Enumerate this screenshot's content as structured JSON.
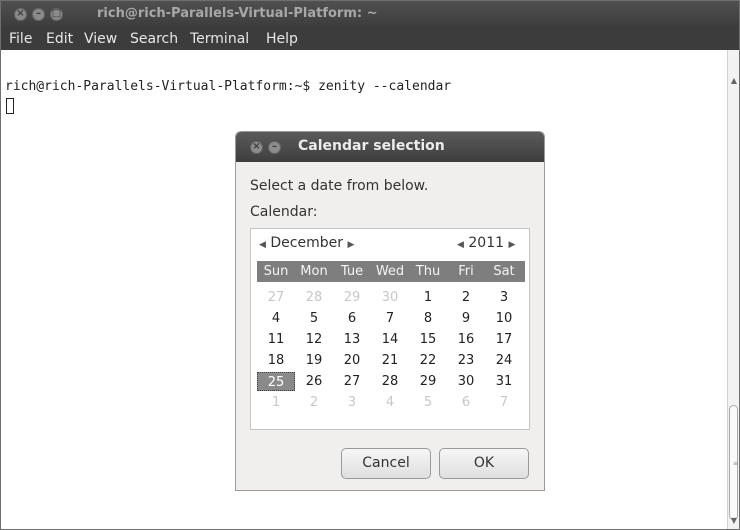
{
  "window": {
    "title": "rich@rich-Parallels-Virtual-Platform: ~",
    "menu": [
      "File",
      "Edit",
      "View",
      "Search",
      "Terminal",
      "Help"
    ]
  },
  "terminal": {
    "prompt_line": "rich@rich-Parallels-Virtual-Platform:~$ zenity --calendar"
  },
  "dialog": {
    "title": "Calendar selection",
    "prompt_text": "Select a date from below.",
    "calendar_label": "Calendar:",
    "month": "December",
    "year": "2011",
    "weekdays": [
      "Sun",
      "Mon",
      "Tue",
      "Wed",
      "Thu",
      "Fri",
      "Sat"
    ],
    "weeks": [
      [
        "27",
        "28",
        "29",
        "30",
        "1",
        "2",
        "3"
      ],
      [
        "4",
        "5",
        "6",
        "7",
        "8",
        "9",
        "10"
      ],
      [
        "11",
        "12",
        "13",
        "14",
        "15",
        "16",
        "17"
      ],
      [
        "18",
        "19",
        "20",
        "21",
        "22",
        "23",
        "24"
      ],
      [
        "25",
        "26",
        "27",
        "28",
        "29",
        "30",
        "31"
      ],
      [
        "1",
        "2",
        "3",
        "4",
        "5",
        "6",
        "7"
      ]
    ],
    "other_month_days": [
      [
        0,
        0
      ],
      [
        0,
        1
      ],
      [
        0,
        2
      ],
      [
        0,
        3
      ],
      [
        5,
        0
      ],
      [
        5,
        1
      ],
      [
        5,
        2
      ],
      [
        5,
        3
      ],
      [
        5,
        4
      ],
      [
        5,
        5
      ],
      [
        5,
        6
      ]
    ],
    "selected_day": "25",
    "cancel_label": "Cancel",
    "ok_label": "OK"
  },
  "colors": {
    "titlebar": "#3c3c3c",
    "dialog_bg": "#f0efed",
    "day_header_bg": "#7e7e7e",
    "selected_day_bg": "#8a8a8a"
  },
  "icons": {
    "window_close": "close-icon",
    "window_minimize": "minimize-icon",
    "window_maximize": "maximize-icon",
    "nav_prev": "triangle-left-icon",
    "nav_next": "triangle-right-icon"
  }
}
